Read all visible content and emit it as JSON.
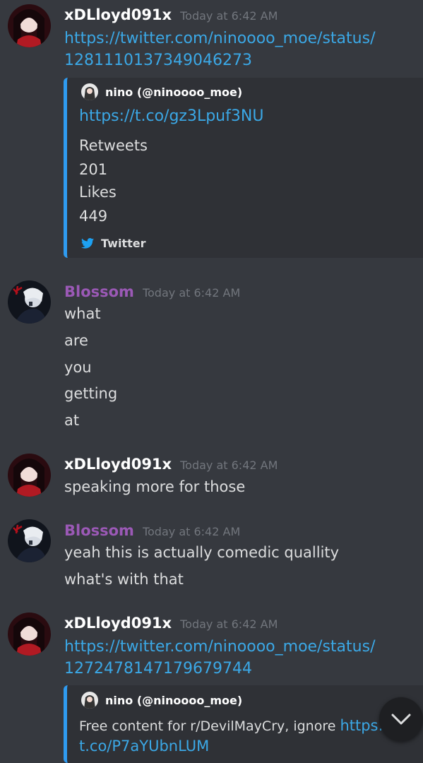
{
  "messages": [
    {
      "author": "xDLloyd091x",
      "timestamp": "Today at 6:42 AM",
      "link": [
        "https://twitter.com/ninoooo_moe/status/",
        "1281110137349046273"
      ],
      "embed": {
        "author": "nino (@ninoooo_moe)",
        "link": "https://t.co/gz3Lpuf3NU",
        "fields": [
          {
            "name": "Retweets",
            "value": "201"
          },
          {
            "name": "Likes",
            "value": "449"
          }
        ],
        "footer": "Twitter"
      }
    },
    {
      "author": "Blossom",
      "timestamp": "Today at 6:42 AM",
      "lines": [
        "what",
        "are",
        "you",
        "getting",
        "at"
      ]
    },
    {
      "author": "xDLloyd091x",
      "timestamp": "Today at 6:42 AM",
      "lines": [
        "speaking more for those"
      ]
    },
    {
      "author": "Blossom",
      "timestamp": "Today at 6:42 AM",
      "lines": [
        "yeah this is actually comedic quallity",
        "what's with that"
      ]
    },
    {
      "author": "xDLloyd091x",
      "timestamp": "Today at 6:42 AM",
      "link": [
        "https://twitter.com/ninoooo_moe/status/",
        "1272478147179679744"
      ],
      "embed": {
        "author": "nino (@ninoooo_moe)",
        "text": "Free content for r/DevilMayCry, ignore ",
        "text_link": "https://",
        "text_link_cont": "t.co/P7aYUbnLUM"
      }
    }
  ],
  "icons": {
    "scroll_down": "chevron-down-icon",
    "twitter": "twitter-bird-icon"
  },
  "colors": {
    "background": "#36393f",
    "embed_bg": "#2f3136",
    "embed_border": "#2f9bf0",
    "link": "#3ba8e6",
    "blossom_name": "#9b59b6",
    "timestamp": "#72767d"
  }
}
